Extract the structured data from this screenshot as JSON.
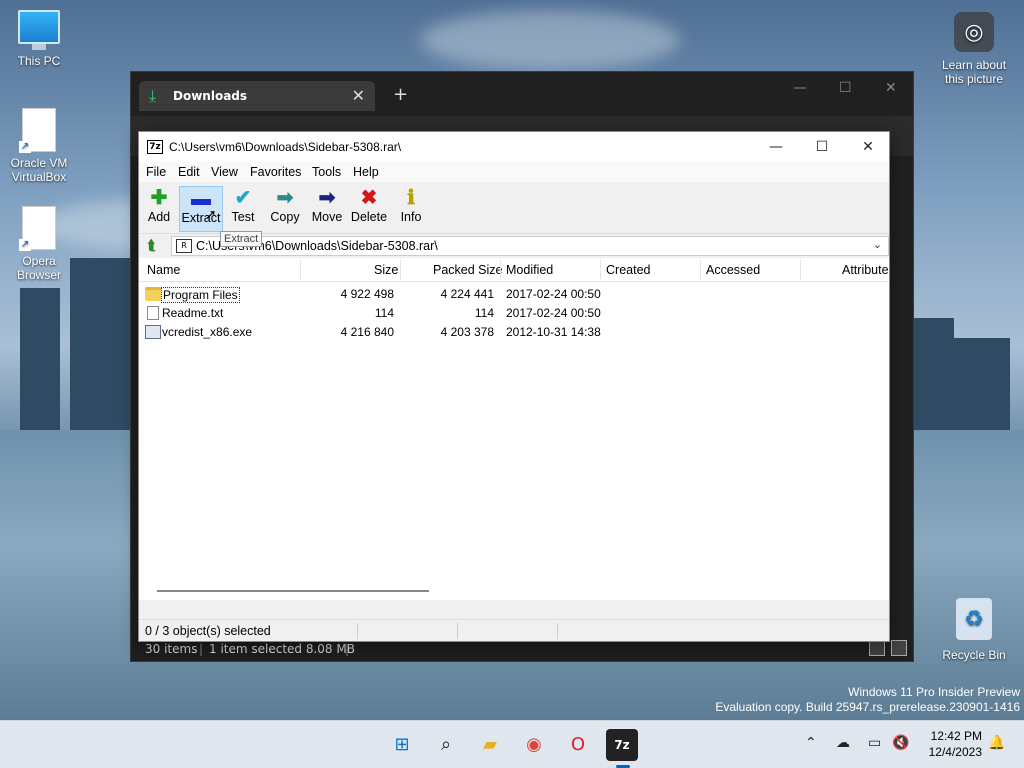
{
  "desktop": {
    "icons": [
      {
        "label": "This PC"
      },
      {
        "label": "Oracle VM VirtualBox"
      },
      {
        "label": "Opera Browser"
      },
      {
        "label": "Recycle Bin"
      },
      {
        "label": "Learn about this picture"
      }
    ],
    "watermark_line1": "Windows 11 Pro Insider Preview",
    "watermark_line2": "Evaluation copy. Build 25947.rs_prerelease.230901-1416"
  },
  "browser": {
    "tab_title": "Downloads",
    "status_items": "30 items",
    "status_selected": "1 item selected  8.08 MB"
  },
  "zip": {
    "title": "C:\\Users\\vm6\\Downloads\\Sidebar-5308.rar\\",
    "app_icon": "7z",
    "menu": [
      "File",
      "Edit",
      "View",
      "Favorites",
      "Tools",
      "Help"
    ],
    "toolbar": [
      {
        "label": "Add",
        "icon": "plus-icon",
        "color": "#22a022"
      },
      {
        "label": "Extract",
        "icon": "minus-icon",
        "color": "#1a2fd0"
      },
      {
        "label": "Test",
        "icon": "check-icon",
        "color": "#1fa8c9"
      },
      {
        "label": "Copy",
        "icon": "copy-arrow-icon",
        "color": "#2a8a8a"
      },
      {
        "label": "Move",
        "icon": "move-arrow-icon",
        "color": "#1a237e"
      },
      {
        "label": "Delete",
        "icon": "x-icon",
        "color": "#d01818"
      },
      {
        "label": "Info",
        "icon": "info-icon",
        "color": "#b8a000"
      }
    ],
    "tooltip": "Extract",
    "address": "C:\\Users\\vm6\\Downloads\\Sidebar-5308.rar\\",
    "columns": [
      "Name",
      "Size",
      "Packed Size",
      "Modified",
      "Created",
      "Accessed",
      "Attribute"
    ],
    "rows": [
      {
        "name": "Program Files",
        "size": "4 922 498",
        "packed": "4 224 441",
        "modified": "2017-02-24 00:50",
        "type": "folder"
      },
      {
        "name": "Readme.txt",
        "size": "114",
        "packed": "114",
        "modified": "2017-02-24 00:50",
        "type": "text"
      },
      {
        "name": "vcredist_x86.exe",
        "size": "4 216 840",
        "packed": "4 203 378",
        "modified": "2012-10-31 14:38",
        "type": "exe"
      }
    ],
    "status": "0 / 3 object(s) selected"
  },
  "taskbar": {
    "time": "12:42 PM",
    "date": "12/4/2023"
  }
}
